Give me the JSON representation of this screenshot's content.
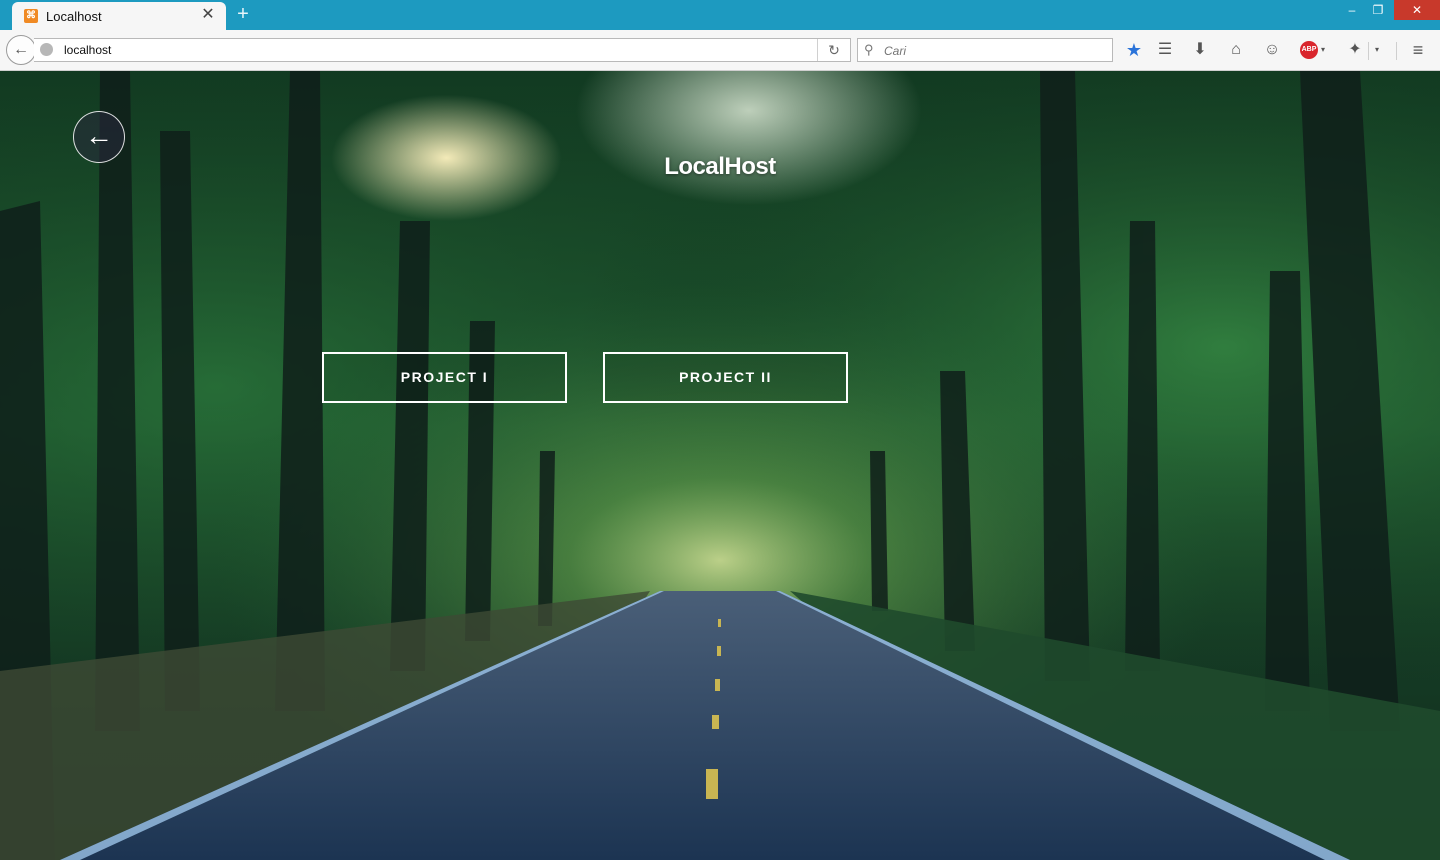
{
  "browser": {
    "tab_title": "Localhost",
    "tab_favicon_glyph": "⌘",
    "tab_close_glyph": "✕",
    "new_tab_glyph": "+",
    "window_controls": {
      "minimize": "–",
      "maximize": "❐",
      "close": "✕"
    },
    "back_glyph": "←",
    "url": "localhost",
    "reload_glyph": "↻",
    "search_placeholder": "Cari",
    "search_glyph": "⚲",
    "toolbar_icons": {
      "bookmark": "★",
      "reading_list": "☰",
      "download": "⬇",
      "home": "⌂",
      "chat": "☺",
      "abp": "ABP",
      "dropdown": "▾",
      "extension": "✦",
      "menu": "≡"
    },
    "accent_color": "#1d9ac0"
  },
  "page": {
    "back_glyph": "←",
    "title": "LocalHost",
    "buttons": [
      {
        "label": "PROJECT I"
      },
      {
        "label": "PROJECT II"
      }
    ],
    "background_description_colors": [
      "#0e3d25",
      "#2b6a3c",
      "#1b3550"
    ]
  }
}
